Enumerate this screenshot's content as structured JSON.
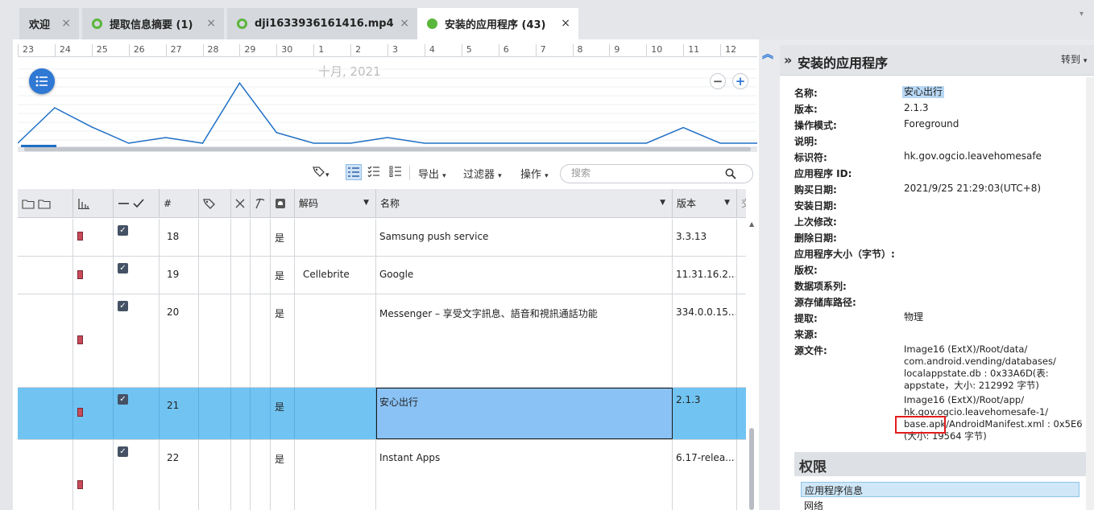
{
  "tabs": [
    {
      "label": "欢迎",
      "close": "×"
    },
    {
      "label": "提取信息摘要 (1)",
      "close": "×"
    },
    {
      "label": "dji1633936161416.mp4",
      "close": "×"
    },
    {
      "label": "安装的应用程序 (43)",
      "close": "×"
    }
  ],
  "timeline": {
    "ticks": [
      "23",
      "24",
      "25",
      "26",
      "27",
      "28",
      "29",
      "30",
      "1",
      "2",
      "3",
      "4",
      "5",
      "6",
      "7",
      "8",
      "9",
      "10",
      "11",
      "12"
    ],
    "month_label": "十月, 2021",
    "zoom_out": "−",
    "zoom_in": "+"
  },
  "timeline_activity": [
    0,
    0.5,
    0.23,
    0,
    0.08,
    0,
    0.85,
    0.15,
    0,
    0,
    0.08,
    0,
    0,
    0,
    0,
    0,
    0,
    0,
    0.22,
    0
  ],
  "toolbar": {
    "export": "导出",
    "filter": "过滤器",
    "action": "操作",
    "search_placeholder": "搜索"
  },
  "table": {
    "headers": {
      "num": "#",
      "decode": "解码",
      "name": "名称",
      "version": "版本"
    },
    "rows": [
      {
        "num": "18",
        "deleted": "是",
        "decode": "",
        "name": "Samsung push service",
        "version": "3.3.13"
      },
      {
        "num": "19",
        "deleted": "是",
        "decode": "Cellebrite",
        "name": "Google",
        "version": "11.31.16.2..."
      },
      {
        "num": "20",
        "deleted": "是",
        "decode": "",
        "name": "Messenger – 享受文字訊息、語音和視訊通話功能",
        "version": "334.0.0.15..."
      },
      {
        "num": "21",
        "deleted": "是",
        "decode": "",
        "name": "安心出行",
        "version": "2.1.3"
      },
      {
        "num": "22",
        "deleted": "是",
        "decode": "",
        "name": "Instant Apps",
        "version": "6.17-relea..."
      }
    ]
  },
  "details": {
    "title": "安装的应用程序",
    "goto": "转到",
    "fields": [
      {
        "label": "名称:",
        "value": "安心出行"
      },
      {
        "label": "版本:",
        "value": "2.1.3"
      },
      {
        "label": "操作模式:",
        "value": "Foreground"
      },
      {
        "label": "说明:",
        "value": ""
      },
      {
        "label": "标识符:",
        "value": "hk.gov.ogcio.leavehomesafe"
      },
      {
        "label": "应用程序 ID:",
        "value": ""
      },
      {
        "label": "购买日期:",
        "value": "2021/9/25 21:29:03(UTC+8)"
      },
      {
        "label": "安装日期:",
        "value": ""
      },
      {
        "label": "上次修改:",
        "value": ""
      },
      {
        "label": "删除日期:",
        "value": ""
      },
      {
        "label": "应用程序大小（字节）:",
        "value": ""
      },
      {
        "label": "版权:",
        "value": ""
      },
      {
        "label": "数据项系列:",
        "value": ""
      },
      {
        "label": "源存储库路径:",
        "value": ""
      },
      {
        "label": "提取:",
        "value": "物理"
      },
      {
        "label": "来源:",
        "value": ""
      },
      {
        "label": "源文件:",
        "value": ""
      }
    ],
    "source_lines": [
      "Image16 (ExtX)/Root/data/",
      "com.android.vending/databases/",
      "localappstate.db : 0x33A6D(表:",
      "appstate，大小: 212992 字节)",
      "Image16 (ExtX)/Root/app/",
      "hk.gov.ogcio.leavehomesafe-1/",
      "base.apk/AndroidManifest.xml : 0x5E6",
      "(大小: 19564 字节)"
    ],
    "permissions_title": "权限",
    "permissions": [
      "应用程序信息",
      "网络"
    ]
  },
  "colors": {
    "accent": "#2f78d4",
    "selected_row": "#71c4f2",
    "tab_dot": "#5bb63c",
    "highlight_box": "#e31c1c"
  }
}
